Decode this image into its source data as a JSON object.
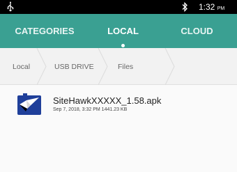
{
  "status_bar": {
    "usb_icon": "usb-icon",
    "bluetooth_icon": "bluetooth-icon",
    "time": "1:32",
    "ampm": "PM"
  },
  "tabs": [
    {
      "label": "CATEGORIES",
      "selected": false
    },
    {
      "label": "LOCAL",
      "selected": true
    },
    {
      "label": "CLOUD",
      "selected": false
    }
  ],
  "breadcrumb": [
    "Local",
    "USB DRIVE",
    "Files"
  ],
  "files": [
    {
      "name": "SiteHawkXXXXX_1.58.apk",
      "date": "Sep 7, 2018, 3:32 PM",
      "size": "1441.23 KB",
      "icon": "apk-file-icon"
    }
  ],
  "colors": {
    "tab_bar": "#3aa092",
    "status_bar": "#000000",
    "breadcrumb_bg": "#f2f2f2",
    "page_bg": "#fafafa"
  }
}
